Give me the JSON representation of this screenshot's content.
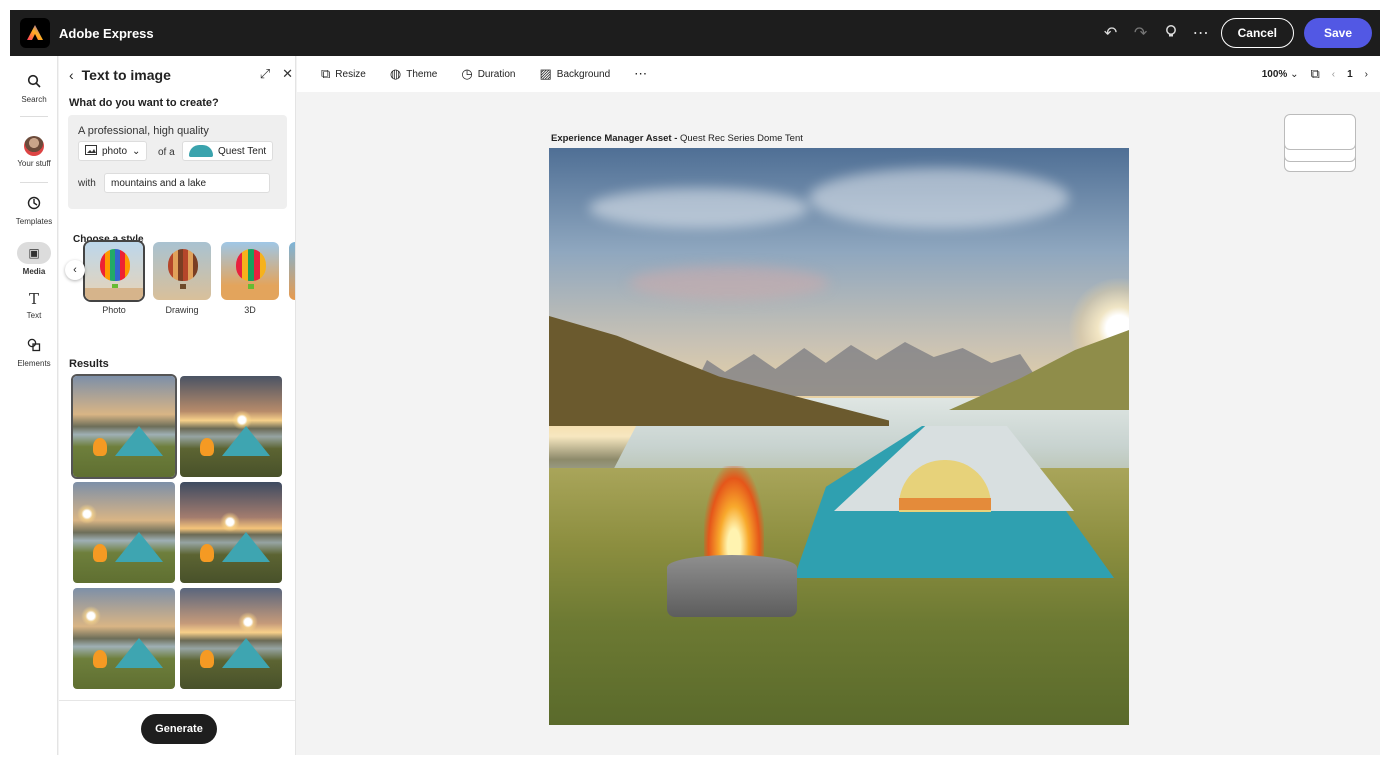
{
  "app": {
    "title": "Adobe Express"
  },
  "header": {
    "cancel_label": "Cancel",
    "save_label": "Save"
  },
  "rail": {
    "items": [
      {
        "label": "Search",
        "icon": "search-icon"
      },
      {
        "label": "Your stuff",
        "icon": "avatar"
      },
      {
        "label": "Templates",
        "icon": "templates-icon"
      },
      {
        "label": "Media",
        "icon": "media-icon",
        "active": true
      },
      {
        "label": "Text",
        "icon": "text-icon"
      },
      {
        "label": "Elements",
        "icon": "elements-icon"
      }
    ]
  },
  "panel": {
    "title": "Text to image",
    "question": "What do you want to create?",
    "prompt": {
      "line1": "A professional, high quality",
      "type_value": "photo",
      "of_a": "of a",
      "subject": "Quest Tent",
      "with": "with",
      "with_value": "mountains and a lake"
    },
    "choose_style": "Choose a style",
    "styles": [
      {
        "label": "Photo",
        "selected": true
      },
      {
        "label": "Drawing"
      },
      {
        "label": "3D"
      }
    ],
    "results_label": "Results",
    "results_count": 6,
    "generate_label": "Generate"
  },
  "toolbar": {
    "items": [
      {
        "label": "Resize",
        "icon": "resize-icon"
      },
      {
        "label": "Theme",
        "icon": "theme-icon"
      },
      {
        "label": "Duration",
        "icon": "clock-icon"
      },
      {
        "label": "Background",
        "icon": "background-icon"
      }
    ],
    "zoom": "100%",
    "page_number": "1"
  },
  "canvas": {
    "caption_bold": "Experience Manager Asset -",
    "caption": " Quest Rec Series Dome Tent"
  },
  "colors": {
    "topbar": "#1d1d1d",
    "save": "#5258e4",
    "accent_tent": "#2fa0b0"
  }
}
